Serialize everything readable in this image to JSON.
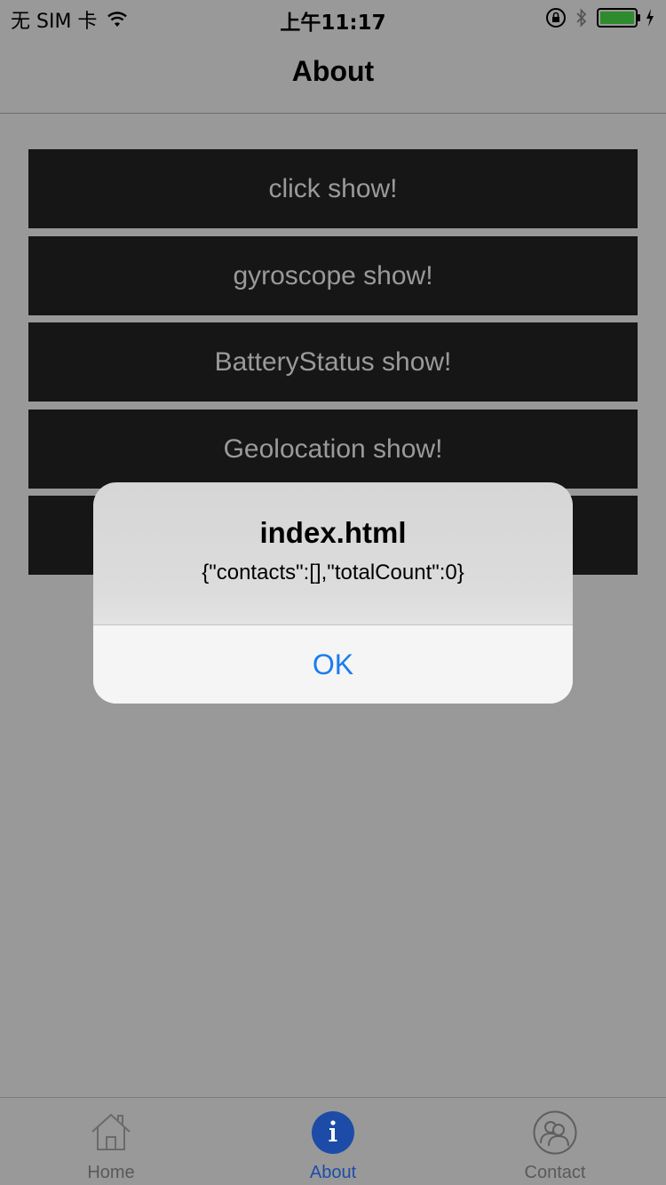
{
  "status_bar": {
    "carrier": "无 SIM 卡",
    "time": "上午11:17",
    "icons": [
      "wifi-icon",
      "orientation-lock-icon",
      "bluetooth-icon",
      "battery-icon",
      "charging-icon"
    ]
  },
  "nav": {
    "title": "About"
  },
  "buttons": [
    {
      "label": "click show!"
    },
    {
      "label": "gyroscope show!"
    },
    {
      "label": "BatteryStatus show!"
    },
    {
      "label": "Geolocation show!"
    },
    {
      "label": ""
    }
  ],
  "alert": {
    "title": "index.html",
    "message": "{\"contacts\":[],\"totalCount\":0}",
    "ok_label": "OK"
  },
  "tab_bar": {
    "tabs": [
      {
        "label": "Home",
        "icon": "home-icon",
        "active": false
      },
      {
        "label": "About",
        "icon": "info-icon",
        "active": true
      },
      {
        "label": "Contact",
        "icon": "contacts-icon",
        "active": false
      }
    ]
  },
  "colors": {
    "background": "#999999",
    "button_bg": "#161616",
    "button_text": "#9a9a9a",
    "alert_action": "#1a7cf0",
    "tab_active": "#1d4ca8",
    "tab_inactive": "#595959",
    "battery_fill": "#2e8b2e"
  }
}
